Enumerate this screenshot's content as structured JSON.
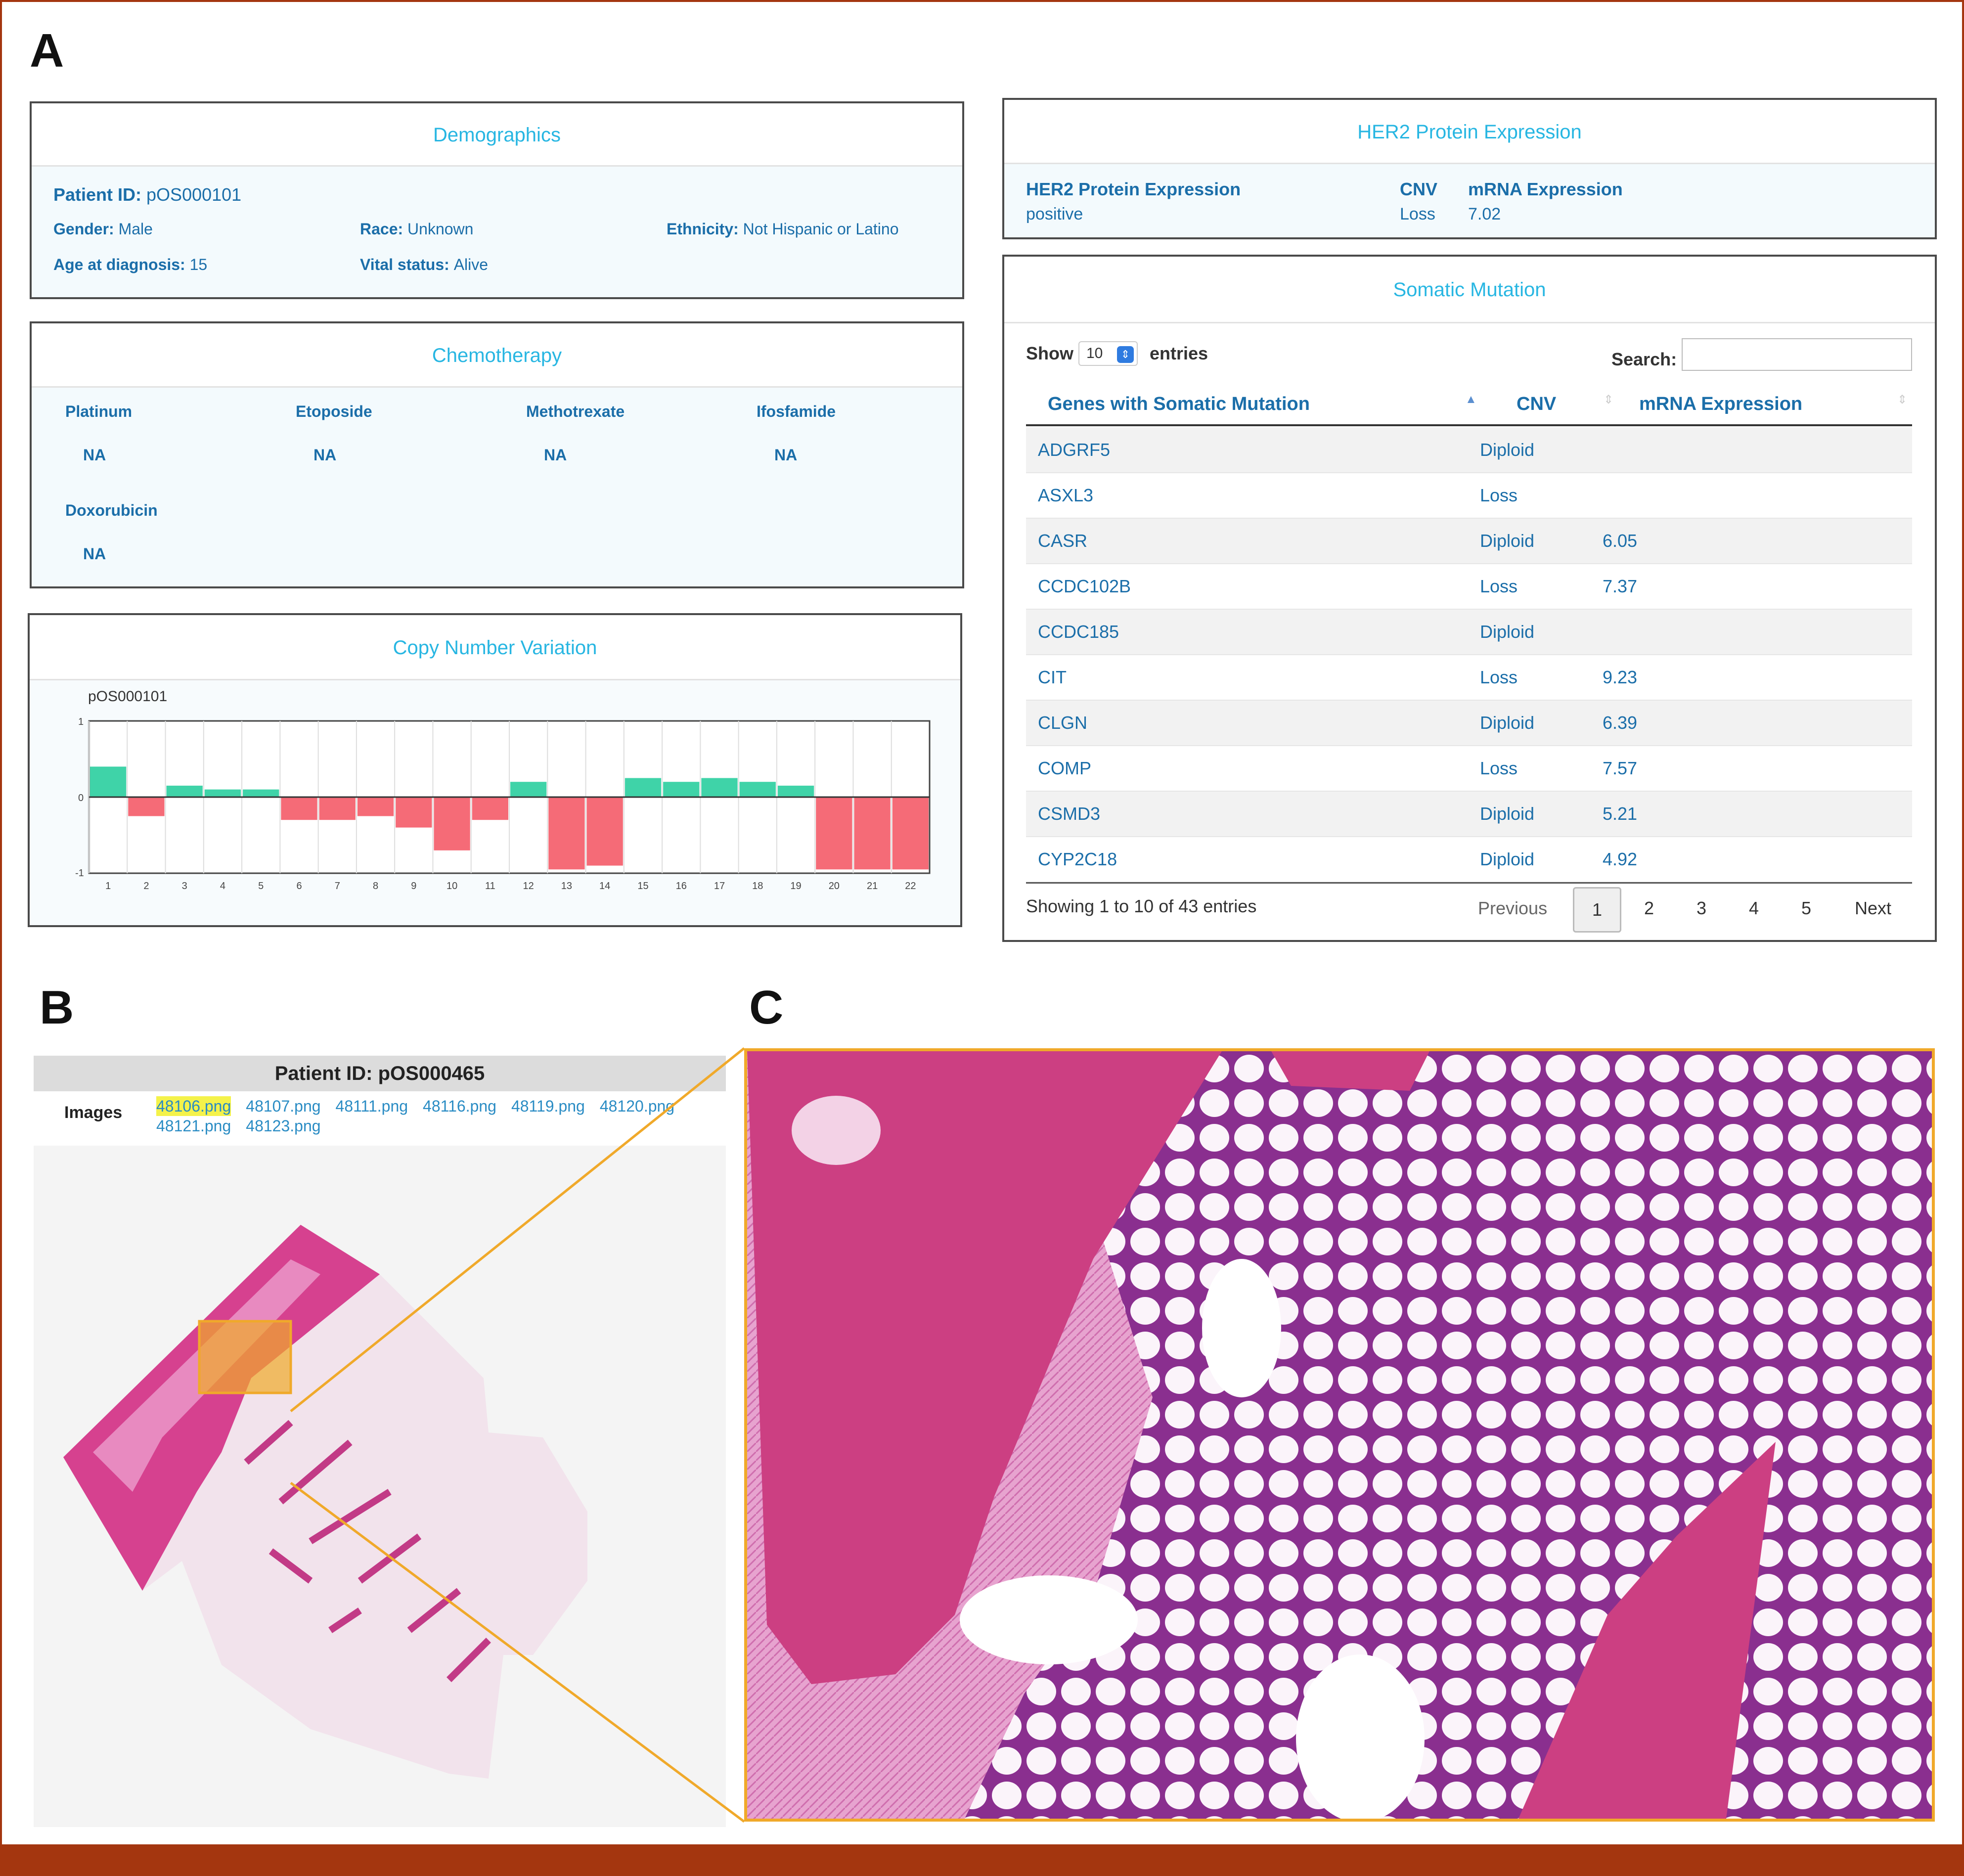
{
  "panels": {
    "a": "A",
    "b": "B",
    "c": "C"
  },
  "demographics": {
    "title": "Demographics",
    "patient_id_label": "Patient ID:",
    "patient_id": "pOS000101",
    "gender_label": "Gender:",
    "gender": "Male",
    "race_label": "Race:",
    "race": "Unknown",
    "ethnicity_label": "Ethnicity:",
    "ethnicity": "Not Hispanic or Latino",
    "age_label": "Age at diagnosis:",
    "age": "15",
    "vital_label": "Vital status:",
    "vital": "Alive"
  },
  "chemotherapy": {
    "title": "Chemotherapy",
    "drugs": [
      {
        "name": "Platinum",
        "value": "NA"
      },
      {
        "name": "Etoposide",
        "value": "NA"
      },
      {
        "name": "Methotrexate",
        "value": "NA"
      },
      {
        "name": "Ifosfamide",
        "value": "NA"
      },
      {
        "name": "Doxorubicin",
        "value": "NA"
      }
    ]
  },
  "cnv": {
    "title": "Copy Number Variation",
    "sample": "pOS000101"
  },
  "chart_data": {
    "type": "bar",
    "title": "pOS000101",
    "xlabel": "",
    "ylabel": "",
    "ylim": [
      -1,
      1
    ],
    "y_ticks": [
      "1",
      "0",
      "-1"
    ],
    "categories": [
      "1",
      "2",
      "3",
      "4",
      "5",
      "6",
      "7",
      "8",
      "9",
      "10",
      "11",
      "12",
      "13",
      "14",
      "15",
      "16",
      "17",
      "18",
      "19",
      "20",
      "21",
      "22"
    ],
    "values": [
      0.4,
      -0.25,
      0.15,
      0.1,
      0.1,
      -0.3,
      -0.3,
      -0.25,
      -0.4,
      -0.7,
      -0.3,
      0.2,
      -0.95,
      -0.9,
      0.25,
      0.2,
      0.25,
      0.2,
      0.15,
      -0.95,
      -0.95,
      -0.95
    ],
    "colors": {
      "gain": "#3fd3a8",
      "loss": "#f56b77"
    },
    "grid": true
  },
  "her2": {
    "title": "HER2 Protein Expression",
    "col1_label": "HER2 Protein Expression",
    "col1_value": "positive",
    "col2_label": "CNV",
    "col2_value": "Loss",
    "col3_label": "mRNA Expression",
    "col3_value": "7.02"
  },
  "somatic": {
    "title": "Somatic Mutation",
    "show_label": "Show",
    "show_value": "10",
    "entries_label": "entries",
    "search_label": "Search:",
    "search_value": "",
    "headers": [
      "Genes with Somatic Mutation",
      "CNV",
      "mRNA Expression"
    ],
    "rows": [
      {
        "gene": "ADGRF5",
        "cnv": "Diploid",
        "mrna": ""
      },
      {
        "gene": "ASXL3",
        "cnv": "Loss",
        "mrna": ""
      },
      {
        "gene": "CASR",
        "cnv": "Diploid",
        "mrna": "6.05"
      },
      {
        "gene": "CCDC102B",
        "cnv": "Loss",
        "mrna": "7.37"
      },
      {
        "gene": "CCDC185",
        "cnv": "Diploid",
        "mrna": ""
      },
      {
        "gene": "CIT",
        "cnv": "Loss",
        "mrna": "9.23"
      },
      {
        "gene": "CLGN",
        "cnv": "Diploid",
        "mrna": "6.39"
      },
      {
        "gene": "COMP",
        "cnv": "Loss",
        "mrna": "7.57"
      },
      {
        "gene": "CSMD3",
        "cnv": "Diploid",
        "mrna": "5.21"
      },
      {
        "gene": "CYP2C18",
        "cnv": "Diploid",
        "mrna": "4.92"
      }
    ],
    "info": "Showing 1 to 10 of 43 entries",
    "previous": "Previous",
    "pages": [
      "1",
      "2",
      "3",
      "4",
      "5"
    ],
    "next": "Next"
  },
  "viewer": {
    "patient_label": "Patient ID:  pOS000465",
    "images_label": "Images",
    "images": [
      "48106.png",
      "48107.png",
      "48111.png",
      "48116.png",
      "48119.png",
      "48120.png",
      "48121.png",
      "48123.png"
    ],
    "selected": "48106.png"
  },
  "colors": {
    "accent": "#27b6e2",
    "link": "#1b6ea9",
    "frame": "#a4360f",
    "highlight": "#f0a92a",
    "tissue": "#d6418f"
  }
}
